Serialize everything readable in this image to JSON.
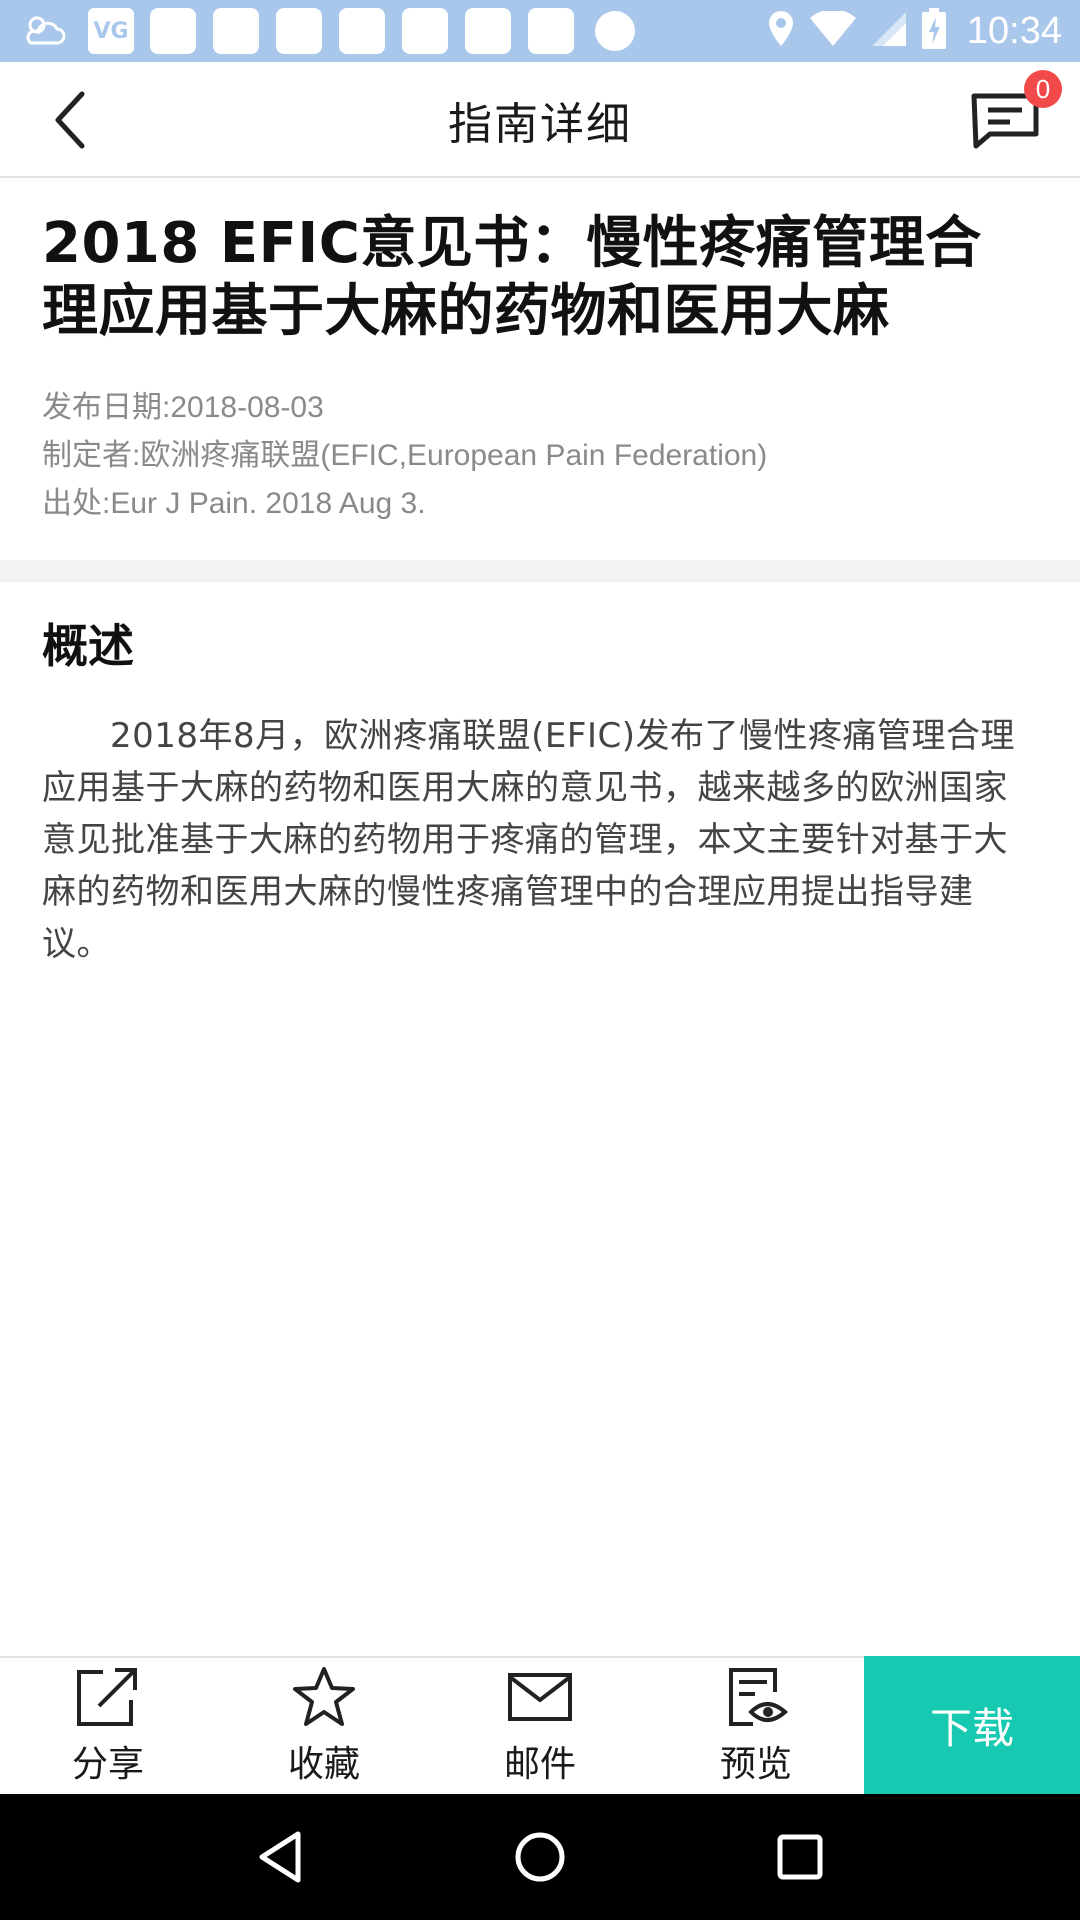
{
  "status_bar": {
    "time": "10:34",
    "app_icon_text": "VG",
    "icons": [
      "weather-icon",
      "vg-app-icon",
      "notification-icon",
      "location-icon",
      "wifi-icon",
      "signal-icon",
      "battery-icon"
    ]
  },
  "app_bar": {
    "title": "指南详细",
    "message_badge": "0"
  },
  "document": {
    "title": "2018 EFIC意见书：慢性疼痛管理合理应用基于大麻的药物和医用大麻",
    "publish_date": "发布日期:2018-08-03",
    "author": "制定者:欧洲疼痛联盟(EFIC,European Pain Federation)",
    "source": "出处:Eur J Pain. 2018 Aug 3."
  },
  "summary": {
    "heading": "概述",
    "body": "2018年8月，欧洲疼痛联盟(EFIC)发布了慢性疼痛管理合理应用基于大麻的药物和医用大麻的意见书，越来越多的欧洲国家意见批准基于大麻的药物用于疼痛的管理，本文主要针对基于大麻的药物和医用大麻的慢性疼痛管理中的合理应用提出指导建议。"
  },
  "actions": {
    "share": "分享",
    "favorite": "收藏",
    "email": "邮件",
    "preview": "预览",
    "download": "下载"
  },
  "colors": {
    "status_bar": "#a9c7ea",
    "download_button": "#17c9b0",
    "badge": "#f24a4a",
    "nav_bar": "#000000"
  }
}
